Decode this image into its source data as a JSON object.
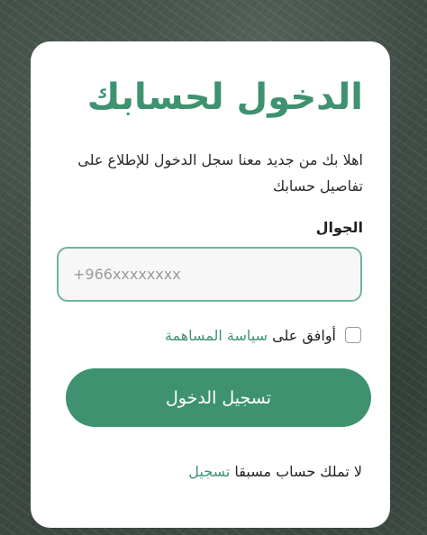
{
  "login": {
    "title": "الدخول لحسابك",
    "subtitle": "اهلا بك من جديد معنا سجل الدخول للإطلاع على تفاصيل حسابك",
    "phone_label": "الجوال",
    "phone_value": "",
    "phone_placeholder": "+966xxxxxxxx",
    "agree_prefix": "أوافق على",
    "agree_link": "سياسة المساهمة",
    "agree_checked": false,
    "submit_label": "تسجيل الدخول",
    "footer_text": "لا تملك حساب مسبقا",
    "register_link": "تسجيل"
  },
  "colors": {
    "accent": "#3e9270",
    "input_border": "#6fb497",
    "card_bg": "#ffffff"
  }
}
